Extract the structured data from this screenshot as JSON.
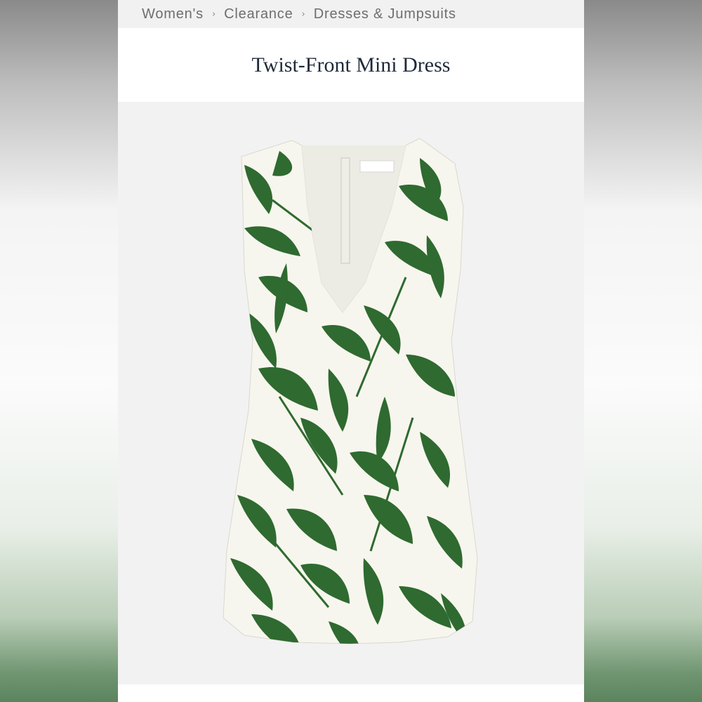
{
  "breadcrumb": {
    "items": [
      "Women's",
      "Clearance",
      "Dresses & Jumpsuits"
    ],
    "separator": "›"
  },
  "product": {
    "title": "Twist-Front Mini Dress",
    "image": {
      "subject": "sleeveless v-neck mini dress, white with green tropical leaf print",
      "print_color": "#2f6a30",
      "base_color": "#f7f6ee"
    }
  },
  "colors": {
    "breadcrumb_bg": "#f1f1f1",
    "breadcrumb_text": "#6e6e6e",
    "title_text": "#1e2a3a",
    "image_bg": "#f2f2f2"
  }
}
